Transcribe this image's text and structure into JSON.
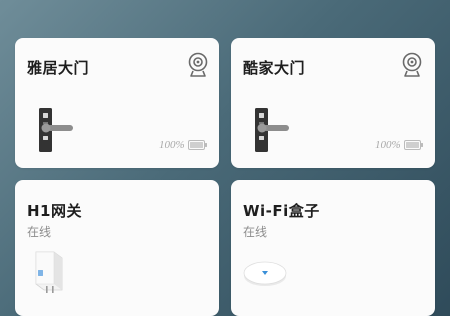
{
  "cards": [
    {
      "title": "雅居大门",
      "battery": "100%",
      "camera_icon": "camera-icon",
      "device_icon": "door-lock-icon",
      "battery_level": 1.0
    },
    {
      "title": "酷家大门",
      "battery": "100%",
      "camera_icon": "camera-icon",
      "device_icon": "door-lock-icon",
      "battery_level": 1.0
    },
    {
      "title": "H1网关",
      "status": "在线",
      "device_icon": "gateway-icon"
    },
    {
      "title": "Wi-Fi盒子",
      "status": "在线",
      "device_icon": "wifi-box-icon"
    }
  ],
  "colors": {
    "background_start": "#6f8d99",
    "background_end": "#2f4b5a",
    "card": "#fbfbfb",
    "title": "#1e1e1e",
    "status": "#8d8d8d",
    "accent_blue": "#3a8fd8"
  }
}
